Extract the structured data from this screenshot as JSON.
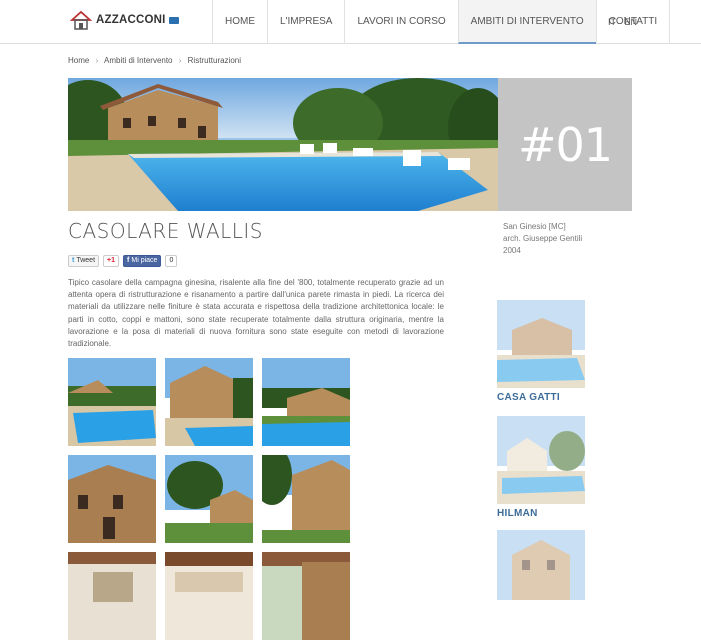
{
  "brand": {
    "name": "AZZACCONI"
  },
  "nav": {
    "items": [
      "HOME",
      "L'IMPRESA",
      "LAVORI IN CORSO",
      "AMBITI DI INTERVENTO",
      "CONTATTI"
    ],
    "active": "AMBITI DI INTERVENTO"
  },
  "lang": {
    "it": "IT",
    "en": "EN"
  },
  "breadcrumb": {
    "home": "Home",
    "section": "Ambiti di Intervento",
    "current": "Ristrutturazioni"
  },
  "project": {
    "number": "#01",
    "title": "CASOLARE WALLIS",
    "location": "San Ginesio [MC]",
    "architect": "arch. Giuseppe Gentili",
    "year": "2004",
    "description": "Tipico casolare della campagna ginesina,  risalente alla fine del '800, totalmente recuperato grazie ad un attenta opera di ristrutturazione  e risanamento a partire dall'unica parete rimasta in piedi. La ricerca dei materiali da utilizzare nelle finiture è stata accurata e rispettosa della tradizione architettonica locale: le parti in cotto, coppi e mattoni, sono state recuperate totalmente dalla struttura originaria, mentre la lavorazione e la posa di materiali di nuova fornitura sono state eseguite con metodi di lavorazione tradizionale."
  },
  "social": {
    "tweet": "Tweet",
    "gplus": "+1",
    "fb": "Mi piace",
    "fb_count": "0"
  },
  "related": {
    "first": "CASA GATTI",
    "second": "HILMAN"
  },
  "colors": {
    "accent": "#3d6c99",
    "number_box": "#c4c4c4",
    "nav_active_line": "#6f9bc8"
  }
}
